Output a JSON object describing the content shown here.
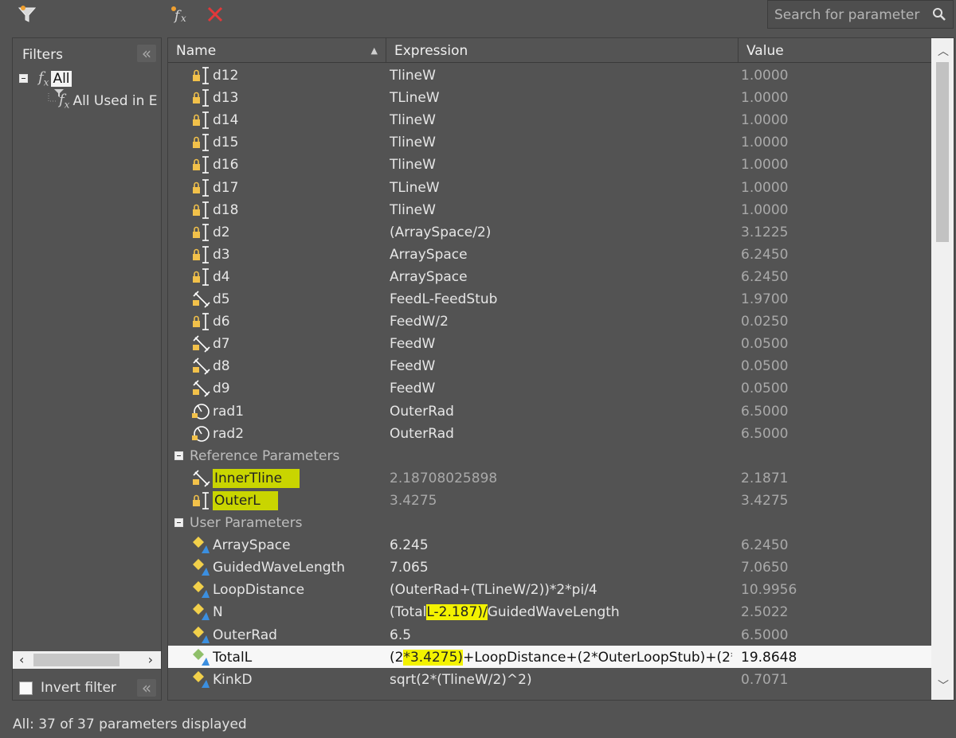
{
  "toolbar": {
    "search_placeholder": "Search for parameter"
  },
  "filters": {
    "title": "Filters",
    "tree_root": "All",
    "tree_child": "All Used in E",
    "invert_label": "Invert filter",
    "collapse_glyph": "«"
  },
  "grid": {
    "columns": {
      "name": "Name",
      "expression": "Expression",
      "value": "Value"
    },
    "sort_glyph": "▲",
    "rows": [
      {
        "name": "d12",
        "expression": "TlineW",
        "value": "1.0000"
      },
      {
        "name": "d13",
        "expression": "TLineW",
        "value": "1.0000"
      },
      {
        "name": "d14",
        "expression": "TlineW",
        "value": "1.0000"
      },
      {
        "name": "d15",
        "expression": "TlineW",
        "value": "1.0000"
      },
      {
        "name": "d16",
        "expression": "TlineW",
        "value": "1.0000"
      },
      {
        "name": "d17",
        "expression": "TLineW",
        "value": "1.0000"
      },
      {
        "name": "d18",
        "expression": "TlineW",
        "value": "1.0000"
      },
      {
        "name": "d2",
        "expression": "(ArraySpace/2)",
        "value": "3.1225"
      },
      {
        "name": "d3",
        "expression": "ArraySpace",
        "value": "6.2450"
      },
      {
        "name": "d4",
        "expression": "ArraySpace",
        "value": "6.2450"
      },
      {
        "name": "d5",
        "expression": "FeedL-FeedStub",
        "value": "1.9700"
      },
      {
        "name": "d6",
        "expression": "FeedW/2",
        "value": "0.0250"
      },
      {
        "name": "d7",
        "expression": "FeedW",
        "value": "0.0500"
      },
      {
        "name": "d8",
        "expression": "FeedW",
        "value": "0.0500"
      },
      {
        "name": "d9",
        "expression": "FeedW",
        "value": "0.0500"
      },
      {
        "name": "rad1",
        "expression": "OuterRad",
        "value": "6.5000"
      },
      {
        "name": "rad2",
        "expression": "OuterRad",
        "value": "6.5000"
      }
    ],
    "reference_group": "Reference Parameters",
    "reference_rows": [
      {
        "name": "InnerTline",
        "expression": "2.18708025898",
        "value": "2.1871"
      },
      {
        "name": "OuterL",
        "expression": "3.4275",
        "value": "3.4275"
      }
    ],
    "user_group": "User Parameters",
    "user_rows": [
      {
        "name": "ArraySpace",
        "expression": "6.245",
        "value": "6.2450"
      },
      {
        "name": "GuidedWaveLength",
        "expression": "7.065",
        "value": "7.0650"
      },
      {
        "name": "LoopDistance",
        "expression": "(OuterRad+(TLineW/2))*2*pi/4",
        "value": "10.9956"
      },
      {
        "name": "N",
        "expression": "(TotalL-2.187)/GuidedWaveLength",
        "expr_parts": [
          "(Total",
          "L-2.187)/",
          "GuidedWaveLength"
        ],
        "value": "2.5022"
      },
      {
        "name": "OuterRad",
        "expression": "6.5",
        "value": "6.5000"
      },
      {
        "name": "TotalL",
        "expression": "(2*3.4275)+LoopDistance+(2*OuterLoopStub)+(2*...",
        "expr_parts": [
          "(2",
          "*3.4275)",
          "+LoopDistance+(2*OuterLoopStub)+(2*..."
        ],
        "value": "19.8648"
      },
      {
        "name": "KinkD",
        "expression": "sqrt(2*(TlineW/2)^2)",
        "value": "0.7071"
      }
    ]
  },
  "status": "All: 37 of 37 parameters displayed"
}
